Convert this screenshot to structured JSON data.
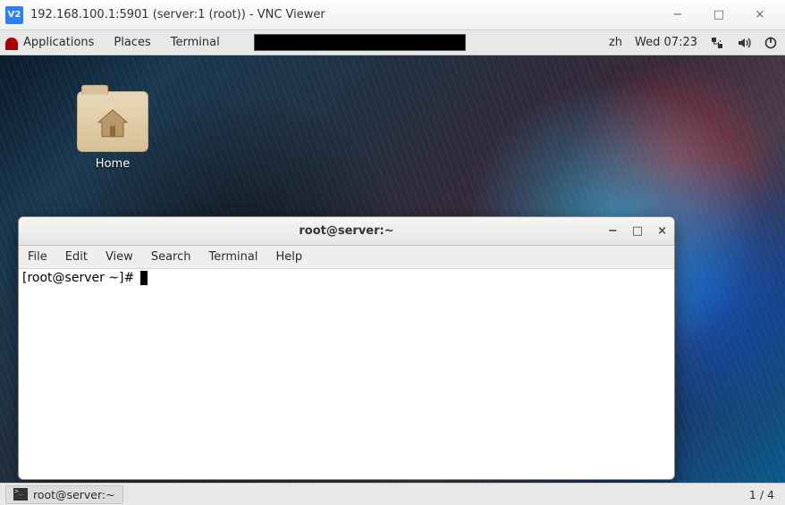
{
  "vnc": {
    "title": "192.168.100.1:5901 (server:1 (root)) - VNC Viewer",
    "logo_text": "V2"
  },
  "gnome": {
    "menus": [
      "Applications",
      "Places",
      "Terminal"
    ],
    "ime": "zh",
    "clock": "Wed 07:23"
  },
  "desktop": {
    "home_label": "Home"
  },
  "terminal": {
    "title": "root@server:~",
    "menus": [
      "File",
      "Edit",
      "View",
      "Search",
      "Terminal",
      "Help"
    ],
    "prompt": "[root@server ~]# "
  },
  "taskbar": {
    "task_label": "root@server:~",
    "workspace": "1 / 4"
  },
  "icons": {
    "network": "network-icon",
    "volume": "volume-icon",
    "power": "power-icon",
    "minimize": "−",
    "maximize": "□",
    "close": "×"
  }
}
